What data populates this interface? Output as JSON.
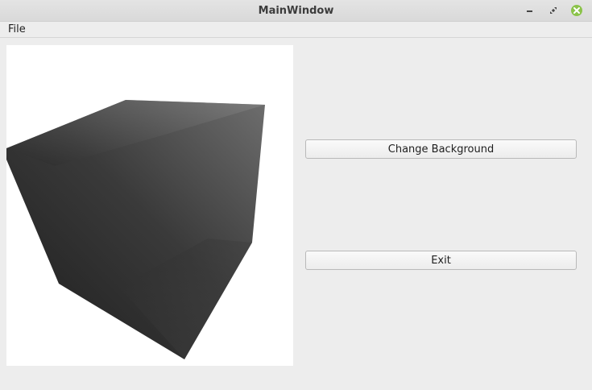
{
  "window": {
    "title": "MainWindow"
  },
  "menubar": {
    "items": [
      {
        "label": "File"
      }
    ]
  },
  "buttons": {
    "change_background": "Change Background",
    "exit": "Exit"
  },
  "icons": {
    "minimize": "minimize-icon",
    "maximize": "maximize-icon",
    "close": "close-icon"
  },
  "colors": {
    "close_button": "#8bc34a",
    "viewport_background": "#ffffff",
    "cube_dark": "#1c1c1c",
    "cube_light": "#8a8a8a"
  }
}
